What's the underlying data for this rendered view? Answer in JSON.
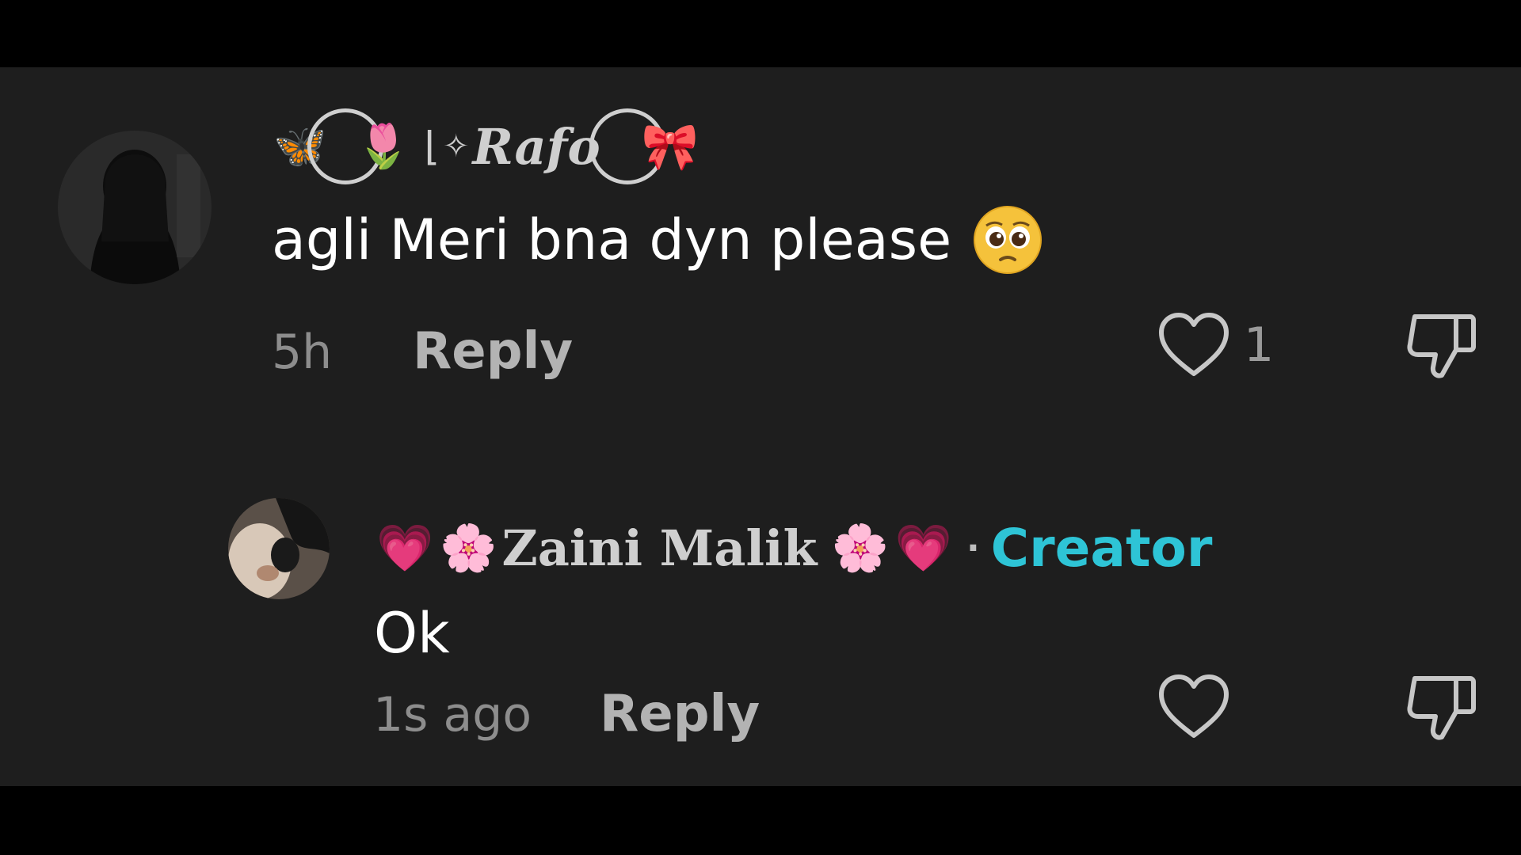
{
  "colors": {
    "background": "#1e1e1e",
    "letterbox": "#000000",
    "creator_accent": "#2ec4d6",
    "text_primary": "#ffffff",
    "text_secondary": "#8d8d8d"
  },
  "comments": [
    {
      "username": {
        "prefix_emoji": "🦋",
        "flower_emoji": "🌷",
        "name": "Rafo",
        "suffix_emoji": "🎀",
        "decor": "✧"
      },
      "text": "agli Meri bna dyn please",
      "text_emoji": "pleading-face-icon",
      "time": "5h",
      "reply_label": "Reply",
      "like_count": "1"
    },
    {
      "username": {
        "prefix_emoji": "💗",
        "flower_emoji": "🌸",
        "name": "Zaini Malik",
        "suffix_flower": "🌸",
        "suffix_heart": "💗"
      },
      "separator": "·",
      "creator_label": "Creator",
      "text": "Ok",
      "time": "1s ago",
      "reply_label": "Reply"
    }
  ]
}
